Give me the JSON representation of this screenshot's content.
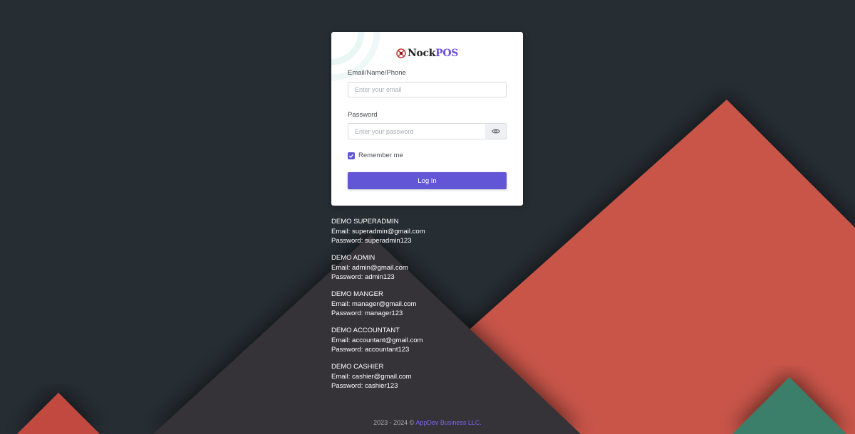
{
  "brand": {
    "name_part1": "Nock",
    "name_part2": "POS",
    "accent_color": "#6356d6"
  },
  "login_form": {
    "email_label": "Email/Name/Phone",
    "email_placeholder": "Enter your email",
    "password_label": "Password",
    "password_placeholder": "Enter your password",
    "toggle_password_icon": "eye-icon",
    "remember_label": "Remember me",
    "remember_checked": true,
    "login_button": "Log In"
  },
  "demo_accounts": [
    {
      "title": "DEMO SUPERADMIN",
      "email": "Email: superadmin@gmail.com",
      "password": "Password: superadmin123"
    },
    {
      "title": "DEMO ADMIN",
      "email": "Email: admin@gmail.com",
      "password": "Password: admin123"
    },
    {
      "title": "DEMO MANGER",
      "email": "Email: manager@gmail.com",
      "password": "Password: manager123"
    },
    {
      "title": "DEMO ACCOUNTANT",
      "email": "Email: accountant@gmail.com",
      "password": "Password: accountant123"
    },
    {
      "title": "DEMO CASHIER",
      "email": "Email: cashier@gmail.com",
      "password": "Password: cashier123"
    }
  ],
  "footer": {
    "copyright": "2023 - 2024 © ",
    "company_link": "AppDev Business LLC."
  },
  "colors": {
    "background": "#262d33",
    "mountain_red": "#c9554a",
    "mountain_dark": "#353337",
    "mountain_green": "#3b7f6a"
  }
}
